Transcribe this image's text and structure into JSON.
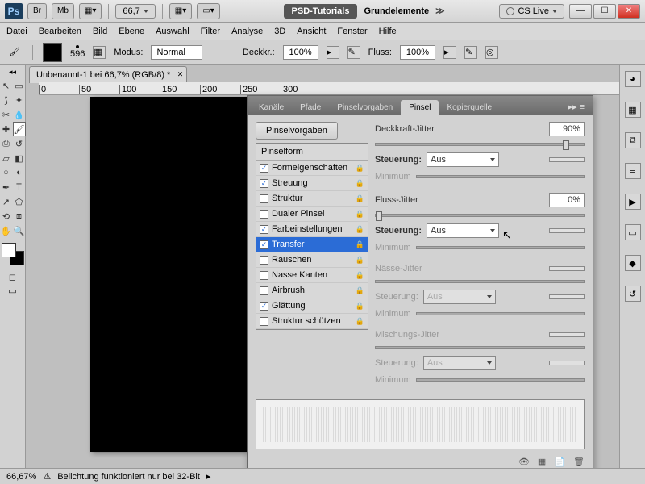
{
  "titlebar": {
    "br": "Br",
    "mb": "Mb",
    "zoom": "66,7",
    "psd": "PSD-Tutorials",
    "grund": "Grundelemente",
    "cslive": "CS Live"
  },
  "menu": [
    "Datei",
    "Bearbeiten",
    "Bild",
    "Ebene",
    "Auswahl",
    "Filter",
    "Analyse",
    "3D",
    "Ansicht",
    "Fenster",
    "Hilfe"
  ],
  "optbar": {
    "size": "596",
    "modus_l": "Modus:",
    "modus_v": "Normal",
    "deck_l": "Deckkr.:",
    "deck_v": "100%",
    "fluss_l": "Fluss:",
    "fluss_v": "100%"
  },
  "doc": {
    "tab": "Unbenannt-1 bei 66,7% (RGB/8) *",
    "ruler": [
      "0",
      "50",
      "100",
      "150",
      "200",
      "250",
      "300"
    ]
  },
  "panel": {
    "tabs": [
      "Kanäle",
      "Pfade",
      "Pinselvorgaben",
      "Pinsel",
      "Kopierquelle"
    ],
    "active": 3,
    "pv_btn": "Pinselvorgaben",
    "list_head": "Pinselform",
    "items": [
      {
        "chk": true,
        "label": "Formeigenschaften"
      },
      {
        "chk": true,
        "label": "Streuung"
      },
      {
        "chk": false,
        "label": "Struktur"
      },
      {
        "chk": false,
        "label": "Dualer Pinsel"
      },
      {
        "chk": true,
        "label": "Farbeinstellungen"
      },
      {
        "chk": true,
        "label": "Transfer",
        "sel": true
      },
      {
        "chk": false,
        "label": "Rauschen"
      },
      {
        "chk": false,
        "label": "Nasse Kanten"
      },
      {
        "chk": false,
        "label": "Airbrush"
      },
      {
        "chk": true,
        "label": "Glättung"
      },
      {
        "chk": false,
        "label": "Struktur schützen"
      }
    ],
    "r": {
      "deckj": "Deckkraft-Jitter",
      "deckj_v": "90%",
      "steuer": "Steuerung:",
      "aus": "Aus",
      "min": "Minimum",
      "flussj": "Fluss-Jitter",
      "flussj_v": "0%",
      "nassj": "Nässe-Jitter",
      "mischj": "Mischungs-Jitter"
    }
  },
  "status": {
    "zoom": "66,67%",
    "msg": "Belichtung funktioniert nur bei 32-Bit"
  }
}
